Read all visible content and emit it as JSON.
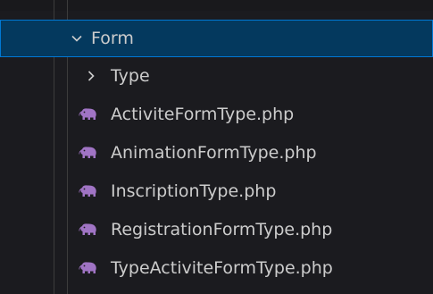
{
  "explorer": {
    "folder": {
      "label": "Form",
      "expanded": true,
      "icon": "chevron-down-icon"
    },
    "subfolder": {
      "label": "Type",
      "expanded": false,
      "icon": "chevron-right-icon"
    },
    "files": [
      {
        "label": "ActiviteFormType.php",
        "icon": "php-elephant-icon"
      },
      {
        "label": "AnimationFormType.php",
        "icon": "php-elephant-icon"
      },
      {
        "label": "InscriptionType.php",
        "icon": "php-elephant-icon"
      },
      {
        "label": "RegistrationFormType.php",
        "icon": "php-elephant-icon"
      },
      {
        "label": "TypeActiviteFormType.php",
        "icon": "php-elephant-icon"
      }
    ],
    "colors": {
      "background": "#1b1b1f",
      "selection": "#04395e",
      "selection_border": "#0078d4",
      "text": "#cccccc",
      "php_icon": "#a074c4"
    }
  }
}
